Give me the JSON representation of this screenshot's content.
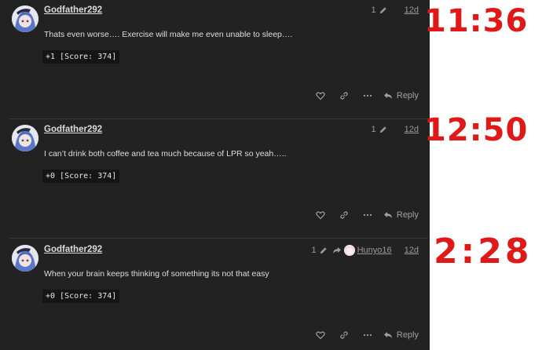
{
  "posts": [
    {
      "username": "Godfather292",
      "edit_count": "1",
      "date": "12d",
      "body": "Thats even worse…. Exercise will make me even unable to sleep….",
      "score": "+1 [Score: 374]",
      "reply_label": "Reply"
    },
    {
      "username": "Godfather292",
      "edit_count": "1",
      "date": "12d",
      "body": "I can’t drink both coffee and tea much because of LPR so yeah…..",
      "score": "+0 [Score: 374]",
      "reply_label": "Reply"
    },
    {
      "username": "Godfather292",
      "edit_count": "1",
      "reply_to_user": "Hunyo16",
      "date": "12d",
      "body": "When your brain keeps thinking of something its not that easy",
      "score": "+0 [Score: 374]",
      "reply_label": "Reply"
    }
  ],
  "annotations": [
    "11:36",
    "12:50",
    "2:28"
  ],
  "colors": {
    "forum_bg": "#222222",
    "annotation_red": "#e01818",
    "score_bg": "#151515"
  }
}
